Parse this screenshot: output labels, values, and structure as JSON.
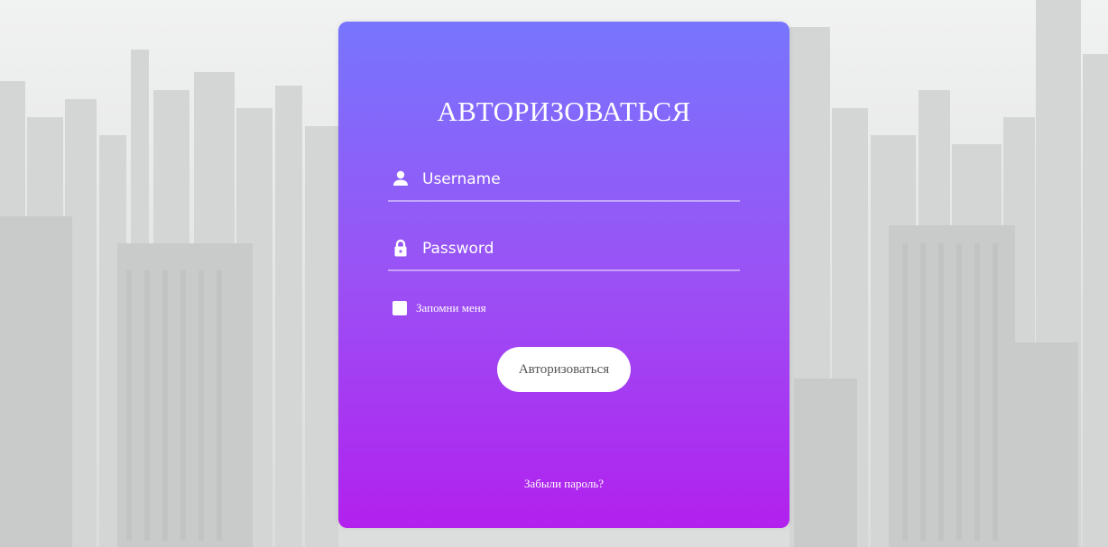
{
  "form": {
    "title": "АВТОРИЗОВАТЬСЯ",
    "username_placeholder": "Username",
    "password_placeholder": "Password",
    "remember_label": "Запомни меня",
    "submit_label": "Авторизоваться",
    "forgot_link": "Забыли пароль?"
  },
  "icons": {
    "username": "user-icon",
    "password": "lock-icon"
  },
  "colors": {
    "gradient_top": "#7775fe",
    "gradient_bottom": "#b220ee",
    "background": "#e9eaea"
  }
}
